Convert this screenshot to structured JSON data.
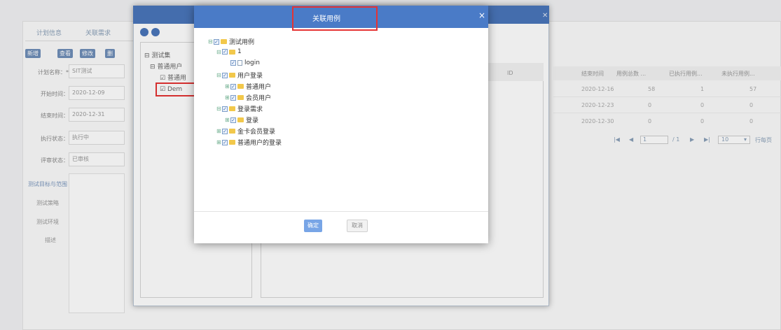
{
  "background": {
    "tabs": [
      "计划信息",
      "关联需求"
    ],
    "toolbar_buttons": [
      "新增",
      "查看",
      "修改",
      "删"
    ],
    "form": [
      {
        "label": "计划名称：*",
        "value": "SIT测试"
      },
      {
        "label": "开始时间：",
        "value": "2020-12-09"
      },
      {
        "label": "结束时间：",
        "value": "2020-12-31"
      },
      {
        "label": "执行状态：",
        "value": "执行中"
      },
      {
        "label": "评审状态：",
        "value": "已审核"
      }
    ],
    "section_title": "测试目标与范围",
    "left_labels": [
      "测试策略",
      "测试环境",
      "描述"
    ],
    "table_headers": [
      "结束时间",
      "用例总数 ...",
      "已执行用例...",
      "未执行用例..."
    ],
    "table_rows": [
      [
        "2020-12-16",
        "58",
        "1",
        "57"
      ],
      [
        "2020-12-23",
        "0",
        "0",
        "0"
      ],
      [
        "2020-12-30",
        "0",
        "0",
        "0"
      ]
    ],
    "pager": {
      "page": "1",
      "total": "/ 1",
      "per_page": "10",
      "suffix": "行每页"
    }
  },
  "mid_dialog": {
    "tree": [
      "测试集",
      "普通用户",
      "普通用",
      "Dem"
    ],
    "id_header": "ID"
  },
  "dialog": {
    "title": "关联用例",
    "close": "×",
    "ok_label": "确定",
    "cancel_label": "取消",
    "tree": [
      {
        "label": "测试用例",
        "level": 0,
        "type": "folder"
      },
      {
        "label": "1",
        "level": 1,
        "type": "folder"
      },
      {
        "label": "login",
        "level": 2,
        "type": "file"
      },
      {
        "label": "用户登录",
        "level": 1,
        "type": "folder"
      },
      {
        "label": "普通用户",
        "level": 2,
        "type": "folder"
      },
      {
        "label": "会员用户",
        "level": 2,
        "type": "folder"
      },
      {
        "label": "登录需求",
        "level": 1,
        "type": "folder"
      },
      {
        "label": "登录",
        "level": 2,
        "type": "folder"
      },
      {
        "label": "金卡会员登录",
        "level": 1,
        "type": "folder"
      },
      {
        "label": "普通用户的登录",
        "level": 1,
        "type": "folder"
      }
    ]
  },
  "colors": {
    "title_bar": "#4a7bc7",
    "highlight": "#e53333",
    "folder": "#f2c84b"
  }
}
